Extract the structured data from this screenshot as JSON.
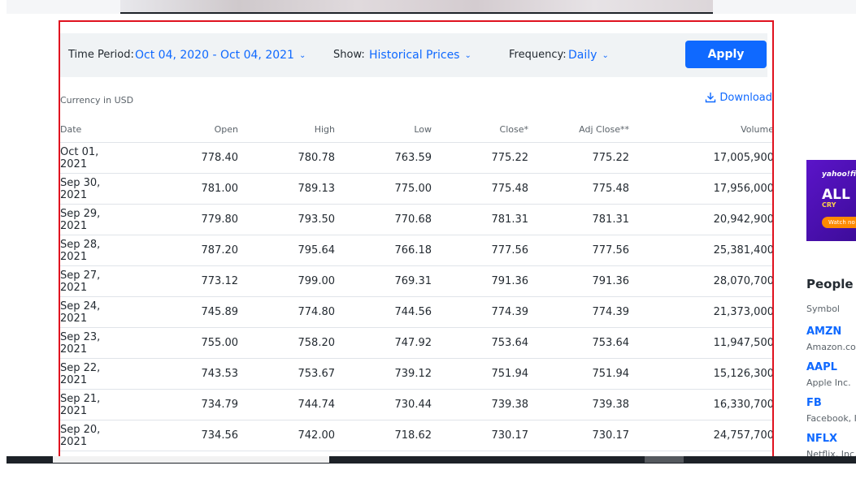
{
  "controls": {
    "time_period_label": "Time Period:",
    "time_period_value": "Oct 04, 2020 - Oct 04, 2021",
    "show_label": "Show:",
    "show_value": "Historical Prices",
    "frequency_label": "Frequency:",
    "frequency_value": "Daily",
    "apply_label": "Apply"
  },
  "currency_note": "Currency in USD",
  "download_label": "Download",
  "table": {
    "headers": [
      "Date",
      "Open",
      "High",
      "Low",
      "Close*",
      "Adj Close**",
      "Volume"
    ],
    "rows": [
      [
        "Oct 01, 2021",
        "778.40",
        "780.78",
        "763.59",
        "775.22",
        "775.22",
        "17,005,900"
      ],
      [
        "Sep 30, 2021",
        "781.00",
        "789.13",
        "775.00",
        "775.48",
        "775.48",
        "17,956,000"
      ],
      [
        "Sep 29, 2021",
        "779.80",
        "793.50",
        "770.68",
        "781.31",
        "781.31",
        "20,942,900"
      ],
      [
        "Sep 28, 2021",
        "787.20",
        "795.64",
        "766.18",
        "777.56",
        "777.56",
        "25,381,400"
      ],
      [
        "Sep 27, 2021",
        "773.12",
        "799.00",
        "769.31",
        "791.36",
        "791.36",
        "28,070,700"
      ],
      [
        "Sep 24, 2021",
        "745.89",
        "774.80",
        "744.56",
        "774.39",
        "774.39",
        "21,373,000"
      ],
      [
        "Sep 23, 2021",
        "755.00",
        "758.20",
        "747.92",
        "753.64",
        "753.64",
        "11,947,500"
      ],
      [
        "Sep 22, 2021",
        "743.53",
        "753.67",
        "739.12",
        "751.94",
        "751.94",
        "15,126,300"
      ],
      [
        "Sep 21, 2021",
        "734.79",
        "744.74",
        "730.44",
        "739.38",
        "739.38",
        "16,330,700"
      ],
      [
        "Sep 20, 2021",
        "734.56",
        "742.00",
        "718.62",
        "730.17",
        "730.17",
        "24,757,700"
      ]
    ]
  },
  "side_ad": {
    "logo": "yahoo!fi",
    "headline": "ALL",
    "sub": "CRY",
    "cta": "Watch no"
  },
  "people_also_watch": {
    "title": "People A",
    "column_label": "Symbol",
    "items": [
      {
        "symbol": "AMZN",
        "name": "Amazon.com"
      },
      {
        "symbol": "AAPL",
        "name": "Apple Inc."
      },
      {
        "symbol": "FB",
        "name": "Facebook, In"
      },
      {
        "symbol": "NFLX",
        "name": "Netflix, Inc."
      }
    ]
  },
  "colors": {
    "accent": "#0f69ff",
    "highlight_border": "#e0121f",
    "controls_bg": "#f0f3f5"
  }
}
